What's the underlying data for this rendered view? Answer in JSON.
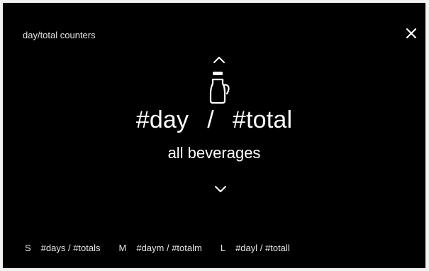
{
  "header": {
    "title": "day/total counters",
    "close_icon": "close-icon"
  },
  "navigation": {
    "up_icon": "chevron-up-icon",
    "down_icon": "chevron-down-icon"
  },
  "beverage": {
    "icon": "carafe-icon",
    "day_value": "#day",
    "separator": "/",
    "total_value": "#total",
    "label": "all beverages"
  },
  "sizes": [
    {
      "letter": "S",
      "value": "#days / #totals"
    },
    {
      "letter": "M",
      "value": "#daym / #totalm"
    },
    {
      "letter": "L",
      "value": "#dayl / #totall"
    }
  ],
  "colors": {
    "background": "#000000",
    "text": "#ffffff",
    "frame": "#f2f2f2"
  }
}
